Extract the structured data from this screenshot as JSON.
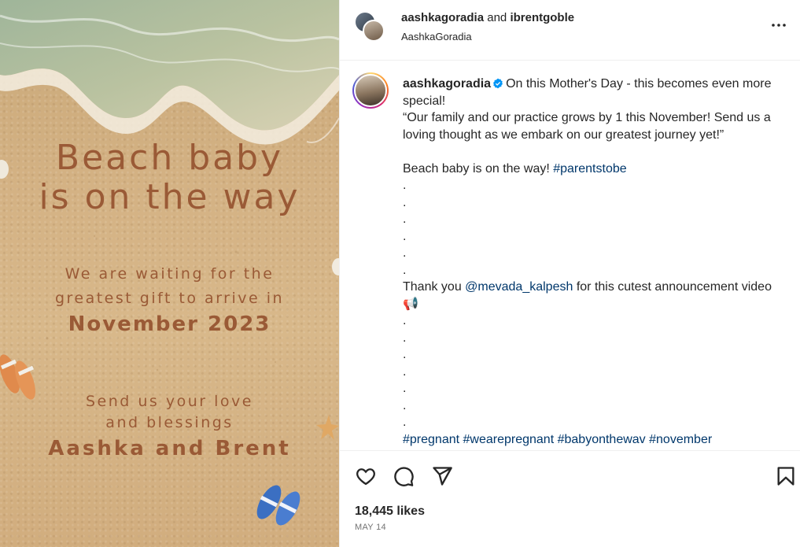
{
  "media": {
    "headline_line1": "Beach baby",
    "headline_line2": "is on the way",
    "waiting_line1": "We are waiting for the",
    "waiting_line2": "greatest gift to arrive in",
    "month_year": "November 2023",
    "send_line1": "Send us your love",
    "send_line2": "and blessings",
    "names": "Aashka and Brent"
  },
  "header": {
    "user1": "aashkagoradia",
    "and_text": " and ",
    "user2": "ibrentgoble",
    "subtitle": "AashkaGoradia"
  },
  "caption": {
    "username": "aashkagoradia",
    "intro": "On this Mother's Day - this becomes even more special!",
    "quote": "“Our family and our practice grows by 1 this November! Send us a loving thought as we embark on our greatest journey yet!”",
    "beach_text": "Beach baby is on the way! ",
    "hashtag_parents": "#parentstobe",
    "dots1": ".\n.\n.\n.\n.\n.",
    "thanks_pre": "Thank you ",
    "mention": "@mevada_kalpesh",
    "thanks_post": " for this cutest announcement video 📢",
    "dots2": ".\n.\n.\n.\n.\n.\n.",
    "hashtags": "#pregnant #wearepregnant #babyonthewav #november"
  },
  "stats": {
    "likes": "18,445 likes",
    "date": "MAY 14"
  },
  "icons": {
    "like": "heart-icon",
    "comment": "comment-icon",
    "share": "share-icon",
    "save": "bookmark-icon",
    "more": "more-icon",
    "verified": "verified-badge-icon"
  },
  "colors": {
    "verified": "#0095f6",
    "link": "#00376b",
    "text_on_sand": "#9a5a36"
  }
}
